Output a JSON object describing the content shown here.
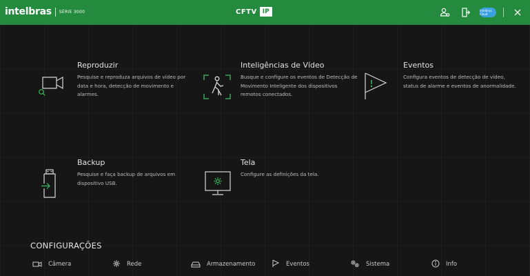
{
  "header": {
    "brand": "intelbras",
    "serie": "SÉRIE 3000",
    "title": "CFTV",
    "title_badge": "IP",
    "cloud_label": "Intelbras Cloud"
  },
  "tiles": [
    {
      "key": "reproduzir",
      "title": "Reproduzir",
      "description": "Pesquise e reproduza arquivos de vídeo por data e hora, detecção de movimento e alarmes.",
      "icon": "playback-camera-search-icon"
    },
    {
      "key": "inteligencias",
      "title": "Inteligências de Vídeo",
      "description": "Busque e configure os eventos de Detecção de Movimento Inteligente dos dispositivos remotos conectados.",
      "icon": "person-detection-icon"
    },
    {
      "key": "eventos",
      "title": "Eventos",
      "description": "Configura eventos de detecção de vídeo, status de alarme e eventos de anormalidade.",
      "icon": "event-flag-icon"
    },
    {
      "key": "backup",
      "title": "Backup",
      "description": "Pesquise e faça backup de arquivos em dispositivo USB.",
      "icon": "usb-backup-icon"
    },
    {
      "key": "tela",
      "title": "Tela",
      "description": "Configure as definições da tela.",
      "icon": "display-settings-icon"
    }
  ],
  "config": {
    "title": "CONFIGURAÇÕES",
    "items": [
      {
        "label": "Câmera",
        "icon": "camera-icon"
      },
      {
        "label": "Rede",
        "icon": "network-icon"
      },
      {
        "label": "Armazenamento",
        "icon": "storage-icon"
      },
      {
        "label": "Eventos",
        "icon": "event-flag-icon"
      },
      {
        "label": "Sistema",
        "icon": "system-gears-icon"
      },
      {
        "label": "Info",
        "icon": "info-icon"
      }
    ]
  },
  "colors": {
    "header_green": "#248a3e",
    "accent_green": "#3fbf5f",
    "background": "#161616",
    "text": "#d6d6d6"
  }
}
